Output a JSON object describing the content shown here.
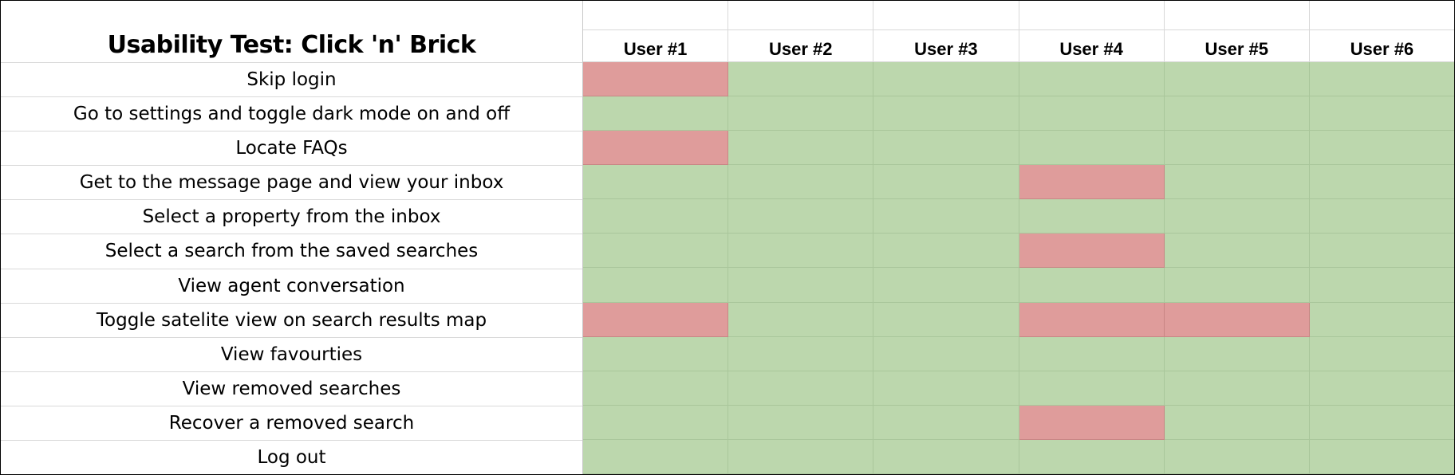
{
  "title": "Usability Test: Click 'n' Brick",
  "users": [
    "User #1",
    "User #2",
    "User #3",
    "User #4",
    "User #5",
    "User #6"
  ],
  "tasks": [
    "Skip login",
    "Go to settings and toggle dark mode on and off",
    "Locate FAQs",
    "Get to the message page and view your inbox",
    "Select a property from the inbox",
    "Select a search from the saved searches",
    "View agent conversation",
    "Toggle satelite view on search results map",
    "View favourties",
    "View removed searches",
    "Recover a removed search",
    "Log out"
  ],
  "results": [
    [
      "fail",
      "pass",
      "pass",
      "pass",
      "pass",
      "pass"
    ],
    [
      "pass",
      "pass",
      "pass",
      "pass",
      "pass",
      "pass"
    ],
    [
      "fail",
      "pass",
      "pass",
      "pass",
      "pass",
      "pass"
    ],
    [
      "pass",
      "pass",
      "pass",
      "fail",
      "pass",
      "pass"
    ],
    [
      "pass",
      "pass",
      "pass",
      "pass",
      "pass",
      "pass"
    ],
    [
      "pass",
      "pass",
      "pass",
      "fail",
      "pass",
      "pass"
    ],
    [
      "pass",
      "pass",
      "pass",
      "pass",
      "pass",
      "pass"
    ],
    [
      "fail",
      "pass",
      "pass",
      "fail",
      "fail",
      "pass"
    ],
    [
      "pass",
      "pass",
      "pass",
      "pass",
      "pass",
      "pass"
    ],
    [
      "pass",
      "pass",
      "pass",
      "pass",
      "pass",
      "pass"
    ],
    [
      "pass",
      "pass",
      "pass",
      "fail",
      "pass",
      "pass"
    ],
    [
      "pass",
      "pass",
      "pass",
      "pass",
      "pass",
      "pass"
    ]
  ],
  "colors": {
    "pass": "#bcd7ad",
    "fail": "#df9c9b"
  }
}
